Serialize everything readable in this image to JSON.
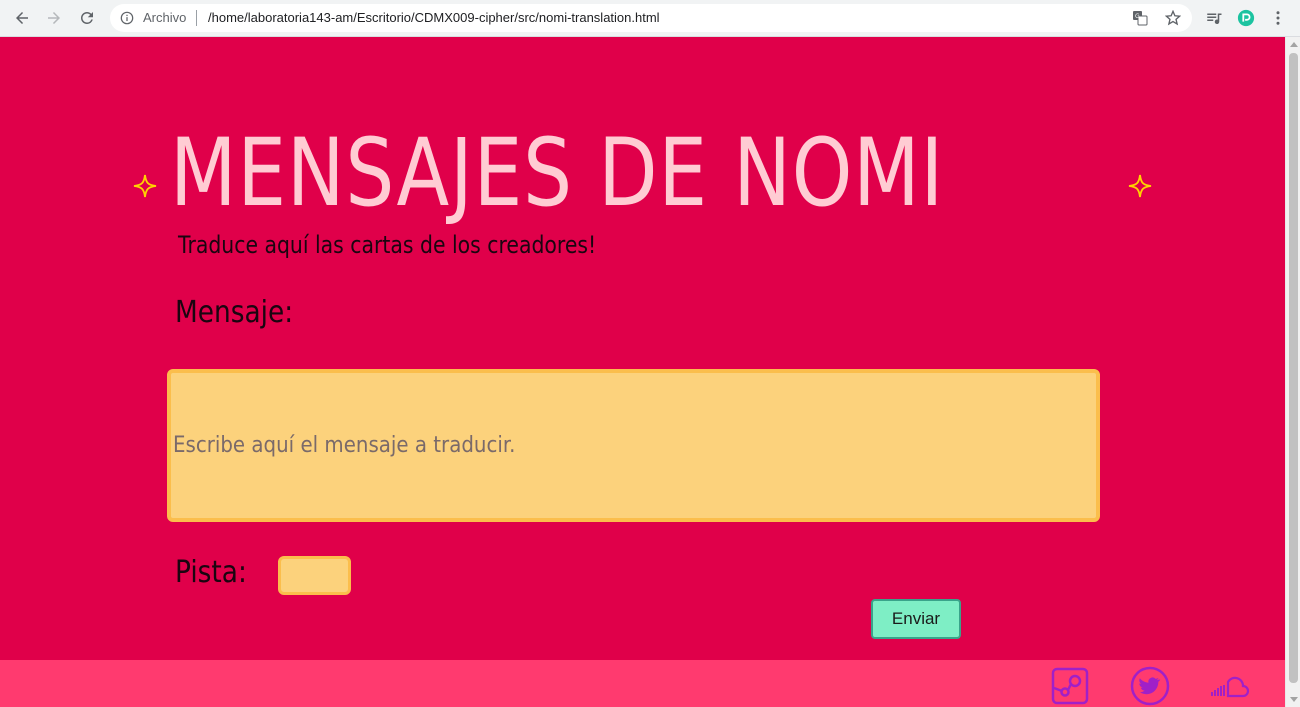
{
  "browser": {
    "origin_label": "Archivo",
    "url": "/home/laboratoria143-am/Escritorio/CDMX009-cipher/src/nomi-translation.html"
  },
  "page": {
    "title": "MENSAJES DE NOMI",
    "subtitle": "Traduce aquí las cartas de los creadores!",
    "message_label": "Mensaje:",
    "message_placeholder": "Escribe aquí el mensaje a traducir.",
    "hint_label": "Pista:",
    "hint_value": "",
    "send_label": "Enviar"
  },
  "footer": {
    "icons": [
      "steam-icon",
      "twitter-icon",
      "soundcloud-icon"
    ]
  },
  "colors": {
    "background": "#e0004a",
    "title": "#ffccd3",
    "input_fill": "#fcd27c",
    "input_border": "#fbbe4c",
    "button": "#7eeec5",
    "footer": "#ff3a6f",
    "icons": "#a020c8",
    "sparkle": "#ffd400"
  }
}
